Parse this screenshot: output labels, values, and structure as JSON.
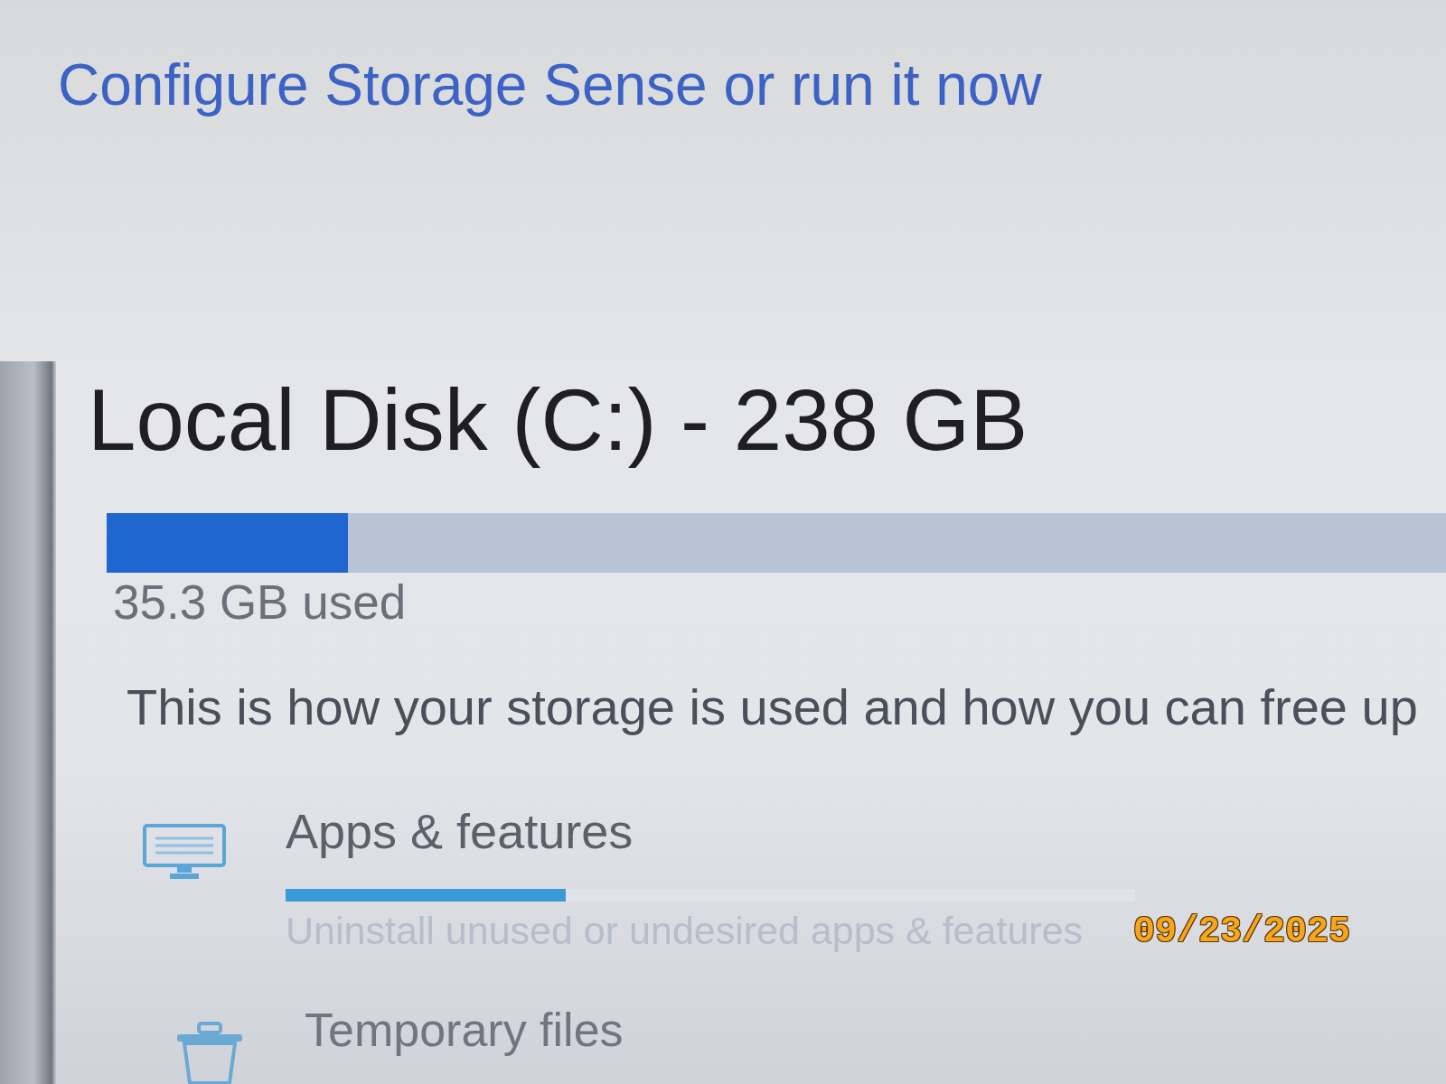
{
  "storage_sense_link": "Configure Storage Sense or run it now",
  "drive": {
    "title": "Local Disk (C:) - 238 GB",
    "usage": {
      "level": 0.18
    },
    "used_label": "35.3 GB used"
  },
  "description": "This is how your storage is used and how you can free up",
  "categories": [
    {
      "kind": "apps",
      "title": "Apps & features",
      "level": 0.33,
      "description": "Uninstall unused or undesired apps & features"
    },
    {
      "kind": "temp",
      "title": "Temporary files"
    }
  ],
  "photo_date_stamp": "09/23/2025"
}
